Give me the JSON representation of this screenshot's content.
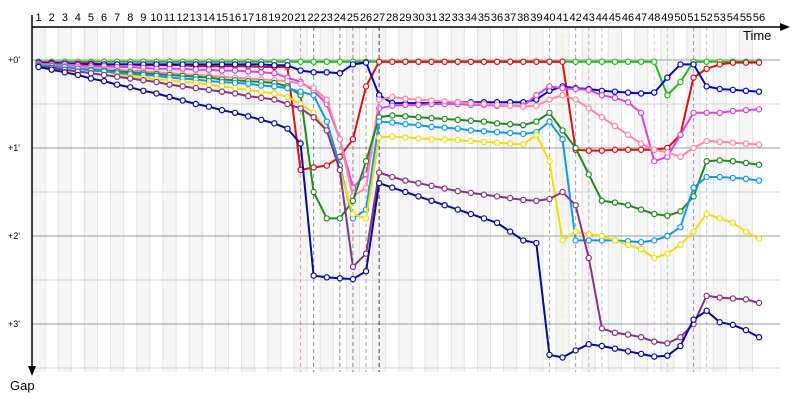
{
  "chart_data": {
    "type": "line",
    "xlabel": "Time",
    "ylabel": "Gap",
    "laps": [
      1,
      2,
      3,
      4,
      5,
      6,
      7,
      8,
      9,
      10,
      11,
      12,
      13,
      14,
      15,
      16,
      17,
      18,
      19,
      20,
      21,
      22,
      23,
      24,
      25,
      26,
      27,
      28,
      29,
      30,
      31,
      32,
      33,
      34,
      35,
      36,
      37,
      38,
      39,
      40,
      41,
      42,
      43,
      44,
      45,
      46,
      47,
      48,
      49,
      50,
      51,
      52,
      53,
      54,
      55,
      56
    ],
    "y_ticks": [
      "+0'",
      "+1'",
      "+2'",
      "+3'"
    ],
    "ylim": [
      0,
      3.5
    ],
    "grid": true,
    "series": [
      {
        "color": "#22bb22",
        "values": [
          0.02,
          0.02,
          0.02,
          0.02,
          0.02,
          0.02,
          0.02,
          0.02,
          0.02,
          0.02,
          0.02,
          0.02,
          0.02,
          0.02,
          0.02,
          0.02,
          0.02,
          0.02,
          0.02,
          0.02,
          0.02,
          0.02,
          0.02,
          0.02,
          0.02,
          0.02,
          0.02,
          0.02,
          0.02,
          0.02,
          0.02,
          0.02,
          0.02,
          0.02,
          0.02,
          0.02,
          0.02,
          0.02,
          0.02,
          0.02,
          0.02,
          0.02,
          0.02,
          0.02,
          0.02,
          0.02,
          0.02,
          0.02,
          0.4,
          0.25,
          0.02,
          0.02,
          0.02,
          0.02,
          0.02,
          0.02
        ]
      },
      {
        "color": "#dd1111",
        "values": [
          0.03,
          0.03,
          0.04,
          0.04,
          0.04,
          0.05,
          0.05,
          0.05,
          0.06,
          0.06,
          0.06,
          0.06,
          0.07,
          0.07,
          0.07,
          0.07,
          0.07,
          0.08,
          0.08,
          0.08,
          1.25,
          1.22,
          1.2,
          1.1,
          0.9,
          0.3,
          0.02,
          0.02,
          0.02,
          0.02,
          0.02,
          0.02,
          0.02,
          0.02,
          0.02,
          0.02,
          0.02,
          0.02,
          0.02,
          0.02,
          0.02,
          1.02,
          1.03,
          1.03,
          1.02,
          1.02,
          1.02,
          1.02,
          1.0,
          0.85,
          0.2,
          0.1,
          0.05,
          0.03,
          0.03,
          0.03
        ]
      },
      {
        "color": "#0000cc",
        "values": [
          0.03,
          0.04,
          0.04,
          0.05,
          0.05,
          0.05,
          0.05,
          0.05,
          0.05,
          0.05,
          0.05,
          0.05,
          0.05,
          0.05,
          0.05,
          0.05,
          0.05,
          0.05,
          0.06,
          0.06,
          0.12,
          0.14,
          0.14,
          0.15,
          0.05,
          0.03,
          0.4,
          0.49,
          0.49,
          0.49,
          0.49,
          0.49,
          0.48,
          0.48,
          0.48,
          0.48,
          0.48,
          0.48,
          0.45,
          0.35,
          0.3,
          0.32,
          0.33,
          0.35,
          0.36,
          0.37,
          0.38,
          0.37,
          0.2,
          0.05,
          0.05,
          0.3,
          0.33,
          0.34,
          0.35,
          0.36
        ]
      },
      {
        "color": "#dd44dd",
        "values": [
          0.04,
          0.05,
          0.05,
          0.06,
          0.07,
          0.07,
          0.08,
          0.08,
          0.09,
          0.1,
          0.1,
          0.1,
          0.11,
          0.11,
          0.12,
          0.12,
          0.13,
          0.14,
          0.15,
          0.2,
          0.25,
          0.35,
          0.5,
          0.9,
          1.45,
          1.3,
          0.55,
          0.52,
          0.51,
          0.51,
          0.5,
          0.5,
          0.5,
          0.51,
          0.51,
          0.52,
          0.52,
          0.52,
          0.4,
          0.3,
          0.32,
          0.33,
          0.34,
          0.4,
          0.43,
          0.48,
          0.6,
          1.15,
          1.1,
          0.85,
          0.6,
          0.6,
          0.6,
          0.58,
          0.57,
          0.56
        ]
      },
      {
        "color": "#ff88aa",
        "values": [
          0.05,
          0.06,
          0.07,
          0.08,
          0.09,
          0.1,
          0.11,
          0.12,
          0.13,
          0.14,
          0.15,
          0.16,
          0.17,
          0.18,
          0.19,
          0.2,
          0.21,
          0.22,
          0.23,
          0.24,
          0.27,
          0.32,
          0.45,
          0.9,
          1.55,
          1.45,
          0.45,
          0.42,
          0.44,
          0.45,
          0.46,
          0.47,
          0.48,
          0.49,
          0.5,
          0.51,
          0.52,
          0.53,
          0.52,
          0.45,
          0.4,
          0.45,
          0.55,
          0.65,
          0.75,
          0.85,
          0.95,
          1.02,
          1.05,
          1.1,
          1.0,
          0.92,
          0.93,
          0.94,
          0.95,
          0.96
        ]
      },
      {
        "color": "#228822",
        "values": [
          0.06,
          0.07,
          0.08,
          0.1,
          0.11,
          0.12,
          0.13,
          0.14,
          0.15,
          0.16,
          0.17,
          0.18,
          0.19,
          0.2,
          0.22,
          0.23,
          0.24,
          0.25,
          0.26,
          0.3,
          0.4,
          1.5,
          1.8,
          1.8,
          1.6,
          1.15,
          0.65,
          0.63,
          0.64,
          0.65,
          0.66,
          0.67,
          0.68,
          0.69,
          0.7,
          0.72,
          0.73,
          0.74,
          0.7,
          0.6,
          0.8,
          1.0,
          1.3,
          1.6,
          1.62,
          1.65,
          1.7,
          1.75,
          1.77,
          1.72,
          1.55,
          1.15,
          1.14,
          1.15,
          1.17,
          1.19
        ]
      },
      {
        "color": "#1199ee",
        "values": [
          0.06,
          0.07,
          0.08,
          0.1,
          0.12,
          0.13,
          0.15,
          0.16,
          0.17,
          0.18,
          0.2,
          0.21,
          0.22,
          0.24,
          0.25,
          0.26,
          0.27,
          0.29,
          0.3,
          0.32,
          0.36,
          0.4,
          0.7,
          1.2,
          1.8,
          1.7,
          0.7,
          0.71,
          0.73,
          0.74,
          0.76,
          0.77,
          0.78,
          0.8,
          0.81,
          0.82,
          0.83,
          0.84,
          0.82,
          0.7,
          0.9,
          2.05,
          2.05,
          2.05,
          2.05,
          2.06,
          2.07,
          2.05,
          2.0,
          1.9,
          1.45,
          1.33,
          1.33,
          1.34,
          1.35,
          1.37
        ]
      },
      {
        "color": "#eedd11",
        "values": [
          0.07,
          0.1,
          0.12,
          0.13,
          0.15,
          0.17,
          0.18,
          0.19,
          0.2,
          0.22,
          0.23,
          0.25,
          0.26,
          0.28,
          0.3,
          0.32,
          0.34,
          0.36,
          0.38,
          0.42,
          0.5,
          0.6,
          0.8,
          1.25,
          1.75,
          1.8,
          0.88,
          0.87,
          0.88,
          0.89,
          0.9,
          0.9,
          0.91,
          0.92,
          0.93,
          0.94,
          0.95,
          0.96,
          0.85,
          1.15,
          2.05,
          1.95,
          1.98,
          2.0,
          2.05,
          2.1,
          2.15,
          2.25,
          2.2,
          2.1,
          1.95,
          1.75,
          1.8,
          1.85,
          1.95,
          2.03
        ]
      },
      {
        "color": "#883388",
        "values": [
          0.07,
          0.09,
          0.11,
          0.13,
          0.15,
          0.17,
          0.19,
          0.21,
          0.23,
          0.25,
          0.28,
          0.3,
          0.32,
          0.34,
          0.36,
          0.38,
          0.41,
          0.43,
          0.45,
          0.5,
          0.55,
          0.65,
          0.8,
          1.25,
          2.35,
          2.2,
          1.28,
          1.33,
          1.37,
          1.4,
          1.43,
          1.46,
          1.49,
          1.51,
          1.53,
          1.55,
          1.57,
          1.59,
          1.6,
          1.58,
          1.5,
          1.65,
          2.25,
          3.05,
          3.1,
          3.12,
          3.15,
          3.2,
          3.22,
          3.15,
          3.0,
          2.68,
          2.7,
          2.71,
          2.72,
          2.76
        ]
      },
      {
        "color": "#0a0a99",
        "values": [
          0.08,
          0.11,
          0.14,
          0.17,
          0.21,
          0.24,
          0.28,
          0.31,
          0.35,
          0.38,
          0.42,
          0.46,
          0.5,
          0.53,
          0.57,
          0.6,
          0.64,
          0.68,
          0.72,
          0.78,
          0.95,
          2.45,
          2.47,
          2.48,
          2.49,
          2.4,
          1.4,
          1.45,
          1.5,
          1.55,
          1.6,
          1.65,
          1.7,
          1.75,
          1.8,
          1.85,
          1.95,
          2.05,
          2.08,
          3.35,
          3.38,
          3.3,
          3.23,
          3.25,
          3.28,
          3.31,
          3.34,
          3.37,
          3.36,
          3.25,
          2.95,
          2.85,
          2.98,
          3.01,
          3.07,
          3.15
        ]
      }
    ]
  }
}
